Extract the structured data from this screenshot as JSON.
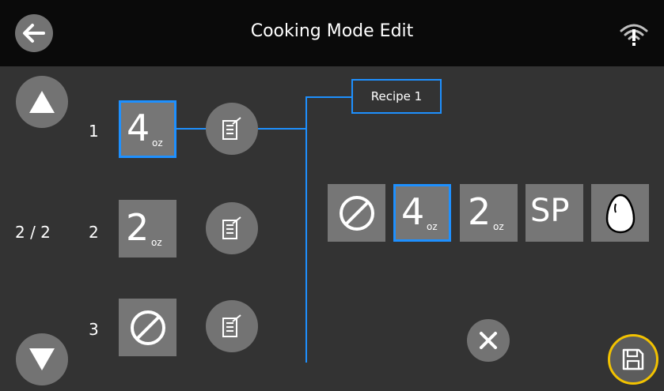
{
  "header": {
    "title": "Cooking Mode Edit",
    "back_icon": "arrow-left-icon",
    "wifi_icon": "wifi-icon"
  },
  "pager": {
    "text": "2 / 2",
    "up_icon": "triangle-up-icon",
    "down_icon": "triangle-down-icon"
  },
  "slots": [
    {
      "index": "1",
      "mode": {
        "number": "4",
        "unit": "oz"
      },
      "selected": true,
      "edit_icon": "edit-note-icon"
    },
    {
      "index": "2",
      "mode": {
        "number": "2",
        "unit": "oz"
      },
      "selected": false,
      "edit_icon": "edit-note-icon"
    },
    {
      "index": "3",
      "mode": {
        "icon": "none-slash-icon"
      },
      "selected": false,
      "edit_icon": "edit-note-icon"
    }
  ],
  "recipe": {
    "label": "Recipe 1"
  },
  "mode_options": [
    {
      "icon": "none-slash-icon",
      "selected": false
    },
    {
      "number": "4",
      "unit": "oz",
      "selected": true
    },
    {
      "number": "2",
      "unit": "oz",
      "selected": false
    },
    {
      "text": "SP",
      "selected": false
    },
    {
      "icon": "egg-icon",
      "selected": false
    }
  ],
  "footer": {
    "close_icon": "close-icon",
    "save_icon": "save-icon"
  },
  "colors": {
    "background": "#333333",
    "header": "#0a0a0a",
    "tile": "#767676",
    "button": "#737373",
    "accent": "#1e90ff",
    "save_ring": "#f2c200"
  }
}
